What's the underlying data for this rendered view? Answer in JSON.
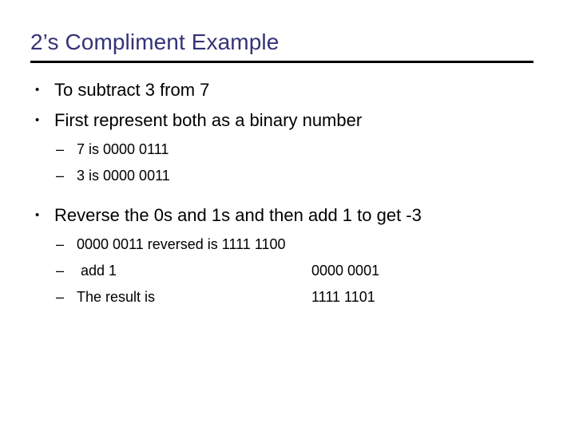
{
  "slide": {
    "title": "2’s Compliment Example",
    "title_color": "#333377",
    "background_color": "#ffffff",
    "text_color": "#000000",
    "bullet_glyph": "•",
    "dash_glyph": "–",
    "value_column_x": 390
  },
  "content": {
    "bullet1": "To subtract 3 from 7",
    "bullet2": "First represent both as a binary number",
    "sub1": "7 is 0000 0111",
    "sub2": "3 is 0000 0011",
    "bullet3": "Reverse the 0s and 1s and then add 1 to get -3",
    "row1_label": "0000 0011 reversed is 1111 1100",
    "row2_label": " add 1",
    "row2_value": "0000 0001",
    "row3_label": "The result is",
    "row3_value": "1111 1101"
  }
}
